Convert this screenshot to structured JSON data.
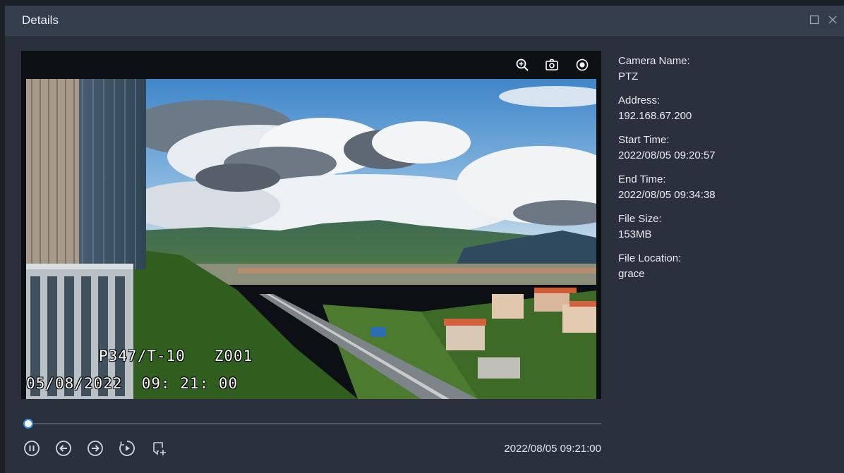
{
  "window": {
    "title": "Details"
  },
  "video": {
    "osd_line1": "P347/T-10   Z001",
    "osd_line2": "05/08/2022  09: 21: 00",
    "toolbar_icons": [
      "zoom-in-icon",
      "snapshot-icon",
      "record-icon"
    ]
  },
  "playback": {
    "current_time": "2022/08/05 09:21:00",
    "progress": 0.008,
    "controls": [
      "pause-icon",
      "previous-icon",
      "next-icon",
      "speed-icon",
      "add-tag-icon"
    ]
  },
  "info": {
    "camera_name_label": "Camera Name:",
    "camera_name": "PTZ",
    "address_label": "Address:",
    "address": "192.168.67.200",
    "start_time_label": "Start Time:",
    "start_time": "2022/08/05 09:20:57",
    "end_time_label": "End Time:",
    "end_time": "2022/08/05 09:34:38",
    "file_size_label": "File Size:",
    "file_size": "153MB",
    "file_location_label": "File Location:",
    "file_location": "grace"
  },
  "colors": {
    "window_bg": "#2a313c",
    "titlebar_bg": "#343d4b",
    "accent": "#3a8ee6"
  }
}
